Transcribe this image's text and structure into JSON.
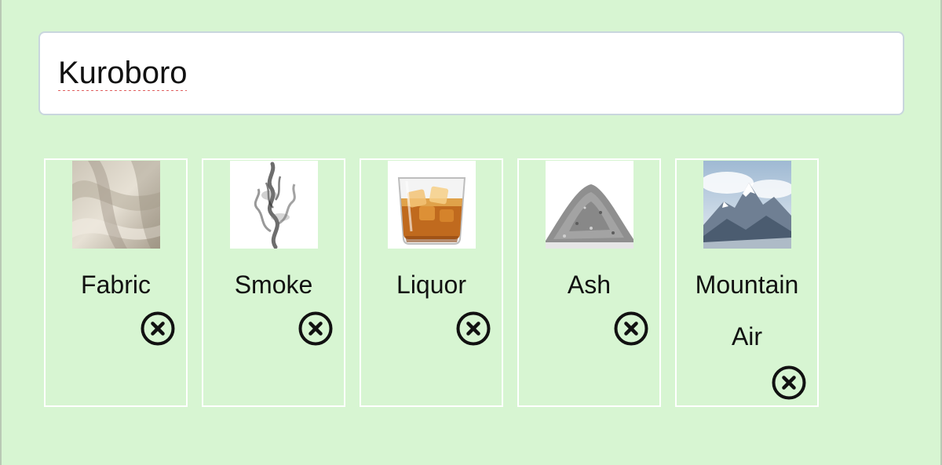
{
  "name_field": {
    "value": "Kuroboro"
  },
  "scent_cards": [
    {
      "label": "Fabric",
      "image_icon": "fabric-image-icon"
    },
    {
      "label": "Smoke",
      "image_icon": "smoke-image-icon"
    },
    {
      "label": "Liquor",
      "image_icon": "liquor-image-icon"
    },
    {
      "label": "Ash",
      "image_icon": "ash-image-icon"
    },
    {
      "label": "Mountain Air",
      "image_icon": "mountain-image-icon"
    }
  ],
  "remove_icon": "close-circle-icon",
  "colors": {
    "background": "#d7f5d2",
    "card_border": "#ffffff",
    "input_border": "#c9d6de",
    "spellcheck_underline": "#e06060"
  }
}
